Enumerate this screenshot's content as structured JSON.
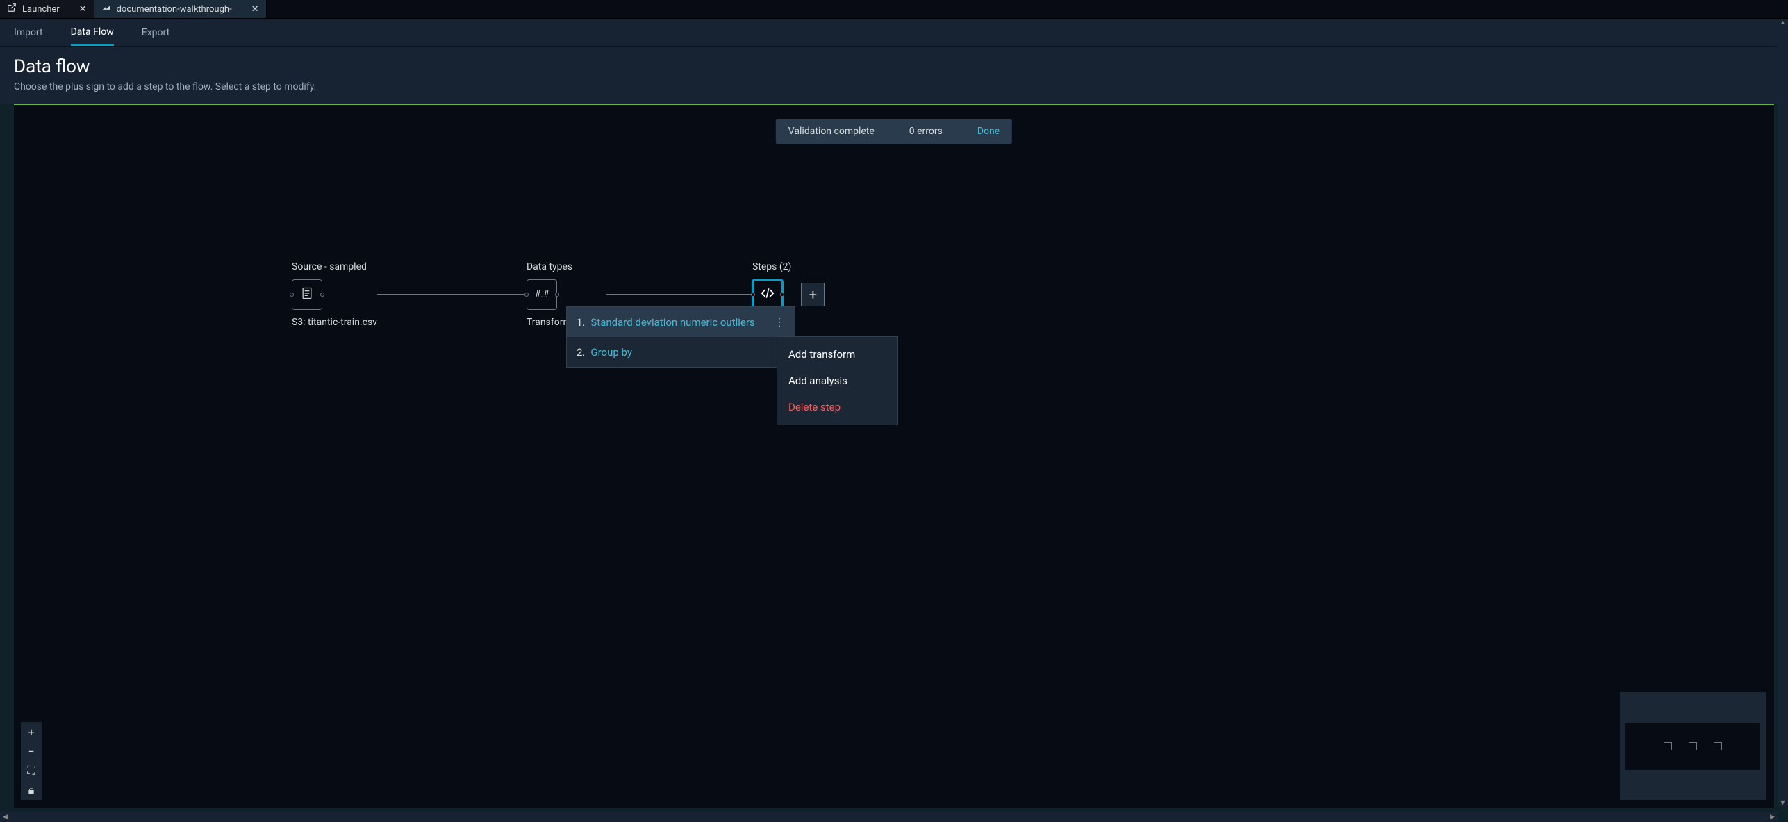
{
  "tabs": {
    "launcher": {
      "label": "Launcher"
    },
    "doc": {
      "label": "documentation-walkthrough-"
    }
  },
  "subnav": {
    "import": "Import",
    "dataflow": "Data Flow",
    "export": "Export"
  },
  "header": {
    "title": "Data flow",
    "subtitle": "Choose the plus sign to add a step to the flow. Select a step to modify."
  },
  "toast": {
    "status": "Validation complete",
    "errors": "0 errors",
    "done": "Done"
  },
  "nodes": {
    "source": {
      "title": "Source - sampled",
      "sub": "S3: titantic-train.csv"
    },
    "types": {
      "title": "Data types",
      "glyph": "#.#",
      "sub": "Transform: titantic-t"
    },
    "steps": {
      "title": "Steps (2)"
    }
  },
  "steps_list": [
    {
      "num": "1.",
      "name": "Standard deviation numeric outliers"
    },
    {
      "num": "2.",
      "name": "Group by"
    }
  ],
  "context_menu": {
    "add_transform": "Add transform",
    "add_analysis": "Add analysis",
    "delete_step": "Delete step"
  }
}
